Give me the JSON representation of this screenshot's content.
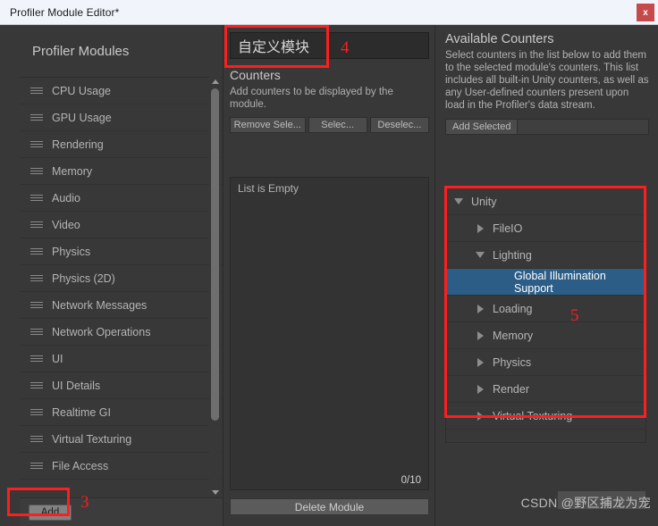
{
  "window": {
    "title": "Profiler Module Editor*",
    "close_label": "x"
  },
  "left_panel": {
    "header": "Profiler Modules",
    "modules": [
      {
        "label": "CPU Usage"
      },
      {
        "label": "GPU Usage"
      },
      {
        "label": "Rendering"
      },
      {
        "label": "Memory"
      },
      {
        "label": "Audio"
      },
      {
        "label": "Video"
      },
      {
        "label": "Physics"
      },
      {
        "label": "Physics (2D)"
      },
      {
        "label": "Network Messages"
      },
      {
        "label": "Network Operations"
      },
      {
        "label": "UI"
      },
      {
        "label": "UI Details"
      },
      {
        "label": "Realtime GI"
      },
      {
        "label": "Virtual Texturing"
      },
      {
        "label": "File Access"
      }
    ],
    "add_button": "Add"
  },
  "middle_panel": {
    "module_name_value": "自定义模块",
    "counters_title": "Counters",
    "counters_description": "Add counters to be displayed by the module.",
    "buttons": {
      "remove_selected": "Remove Sele...",
      "select_all": "Selec...",
      "deselect_all": "Deselec..."
    },
    "list_empty_text": "List is Empty",
    "count_badge": "0/10",
    "delete_module": "Delete Module"
  },
  "right_panel": {
    "title": "Available Counters",
    "description": "Select counters in the list below to add them to the selected module's counters. This list includes all built-in Unity counters, as well as any User-defined counters present upon load in the Profiler's data stream.",
    "add_selected": "Add Selected",
    "tree": [
      {
        "label": "Unity",
        "depth": 0,
        "state": "expanded",
        "selected": false
      },
      {
        "label": "FileIO",
        "depth": 1,
        "state": "collapsed",
        "selected": false
      },
      {
        "label": "Lighting",
        "depth": 1,
        "state": "expanded",
        "selected": false
      },
      {
        "label": "Global Illumination Support",
        "depth": 2,
        "state": "leaf",
        "selected": true
      },
      {
        "label": "Loading",
        "depth": 1,
        "state": "collapsed",
        "selected": false
      },
      {
        "label": "Memory",
        "depth": 1,
        "state": "collapsed",
        "selected": false
      },
      {
        "label": "Physics",
        "depth": 1,
        "state": "collapsed",
        "selected": false
      },
      {
        "label": "Render",
        "depth": 1,
        "state": "collapsed",
        "selected": false
      },
      {
        "label": "Virtual Texturing",
        "depth": 1,
        "state": "collapsed",
        "selected": false
      }
    ]
  },
  "annotations": [
    {
      "number": "3",
      "target": "add-button"
    },
    {
      "number": "4",
      "target": "module-name-field"
    },
    {
      "number": "5",
      "target": "available-counters-tree"
    }
  ],
  "watermark": "CSDN @野区捕龙为宠",
  "colors": {
    "selection_blue": "#2c5d87",
    "annotation_red": "#fb1f1f",
    "close_red": "#c64a4a",
    "panel_bg": "#383838",
    "titlebar_bg": "#f1f5fb"
  }
}
